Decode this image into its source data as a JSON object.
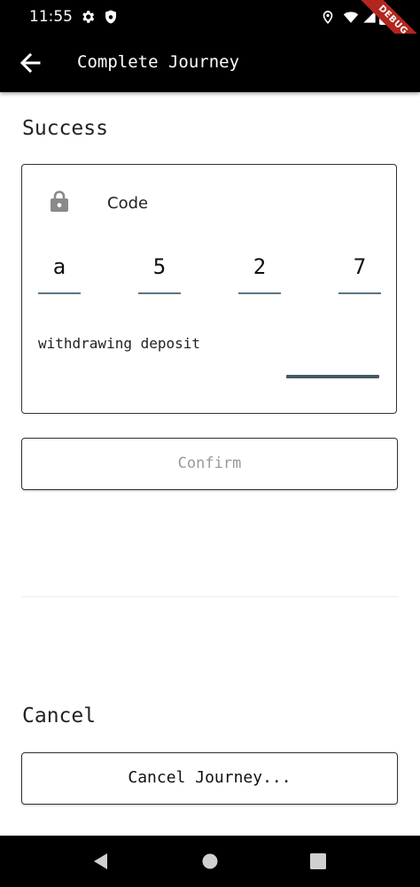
{
  "status_bar": {
    "time": "11:55",
    "debug_banner": "DEBUG"
  },
  "app_bar": {
    "title": "Complete Journey"
  },
  "success_section": {
    "title": "Success",
    "code_label": "Code",
    "digits": [
      "a",
      "5",
      "2",
      "7"
    ],
    "deposit_text": "withdrawing deposit",
    "confirm_label": "Confirm"
  },
  "cancel_section": {
    "title": "Cancel",
    "cancel_label": "Cancel Journey..."
  },
  "colors": {
    "app_bar_bg": "#000000",
    "debug_ribbon": "#b3261e",
    "underline": "#5c7482",
    "disabled_text": "#9a9a9a"
  },
  "icons": {
    "back": "arrow-left",
    "code": "lock",
    "status": [
      "gear",
      "shield",
      "location",
      "wifi",
      "battery"
    ],
    "nav": [
      "back-triangle",
      "home-circle",
      "recents-square"
    ]
  }
}
